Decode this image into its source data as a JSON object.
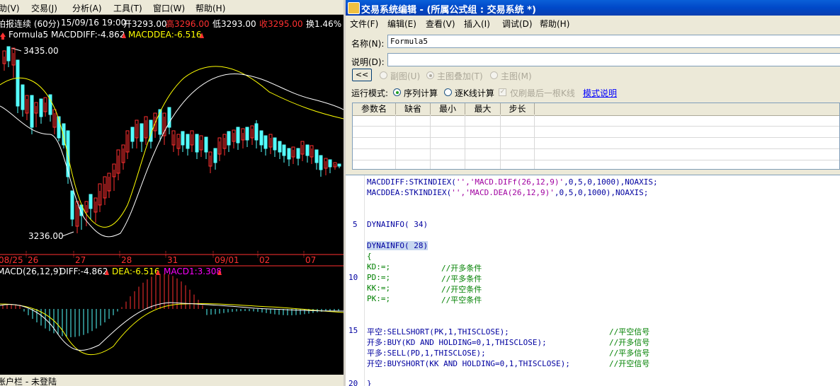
{
  "left_window": {
    "menu": [
      "助(V)",
      "交易(J)",
      "分析(A)",
      "工具(T)",
      "窗口(W)",
      "帮助(H)"
    ],
    "info": {
      "mode": "拍报连续 (60分)",
      "datetime": "15/09/16 19:00",
      "open": "开3293.00",
      "high": "高3296.00",
      "low": "低3293.00",
      "close": "收3295.00",
      "change": "换1.46%"
    },
    "formula_line": {
      "name": "Formula5",
      "diff": "MACDDIFF:-4.862",
      "dea": "MACDDEA:-6.516"
    },
    "price_high": "3435.00",
    "price_low": "3236.00",
    "date_labels": [
      "08/25",
      "26",
      "27",
      "28",
      "31",
      "09/01",
      "02",
      "07"
    ],
    "macd_line": {
      "name": "MACD(26,12,9)",
      "diff": "DIFF:-4.862",
      "dea": "DEA:-6.516",
      "macd": "MACD1:3.308"
    },
    "status": "账户栏 - 未登陆"
  },
  "editor_window": {
    "title": "交易系统编辑 - (所属公式组 : 交易系统 *)",
    "menu": [
      "文件(F)",
      "编辑(E)",
      "查看(V)",
      "插入(I)",
      "调试(D)",
      "帮助(H)"
    ],
    "name_label": "名称(N):",
    "name_value": "Formula5",
    "desc_label": "说明(D):",
    "desc_value": "",
    "collapse_button": "<<",
    "chart_options": [
      "副图(U)",
      "主图叠加(T)",
      "主图(M)"
    ],
    "run_mode_label": "运行模式:",
    "run_modes": [
      "序列计算",
      "逐K线计算"
    ],
    "last_bar_only": "仅刷最后一根K线",
    "mode_help_link": "模式说明",
    "param_headers": [
      "参数名",
      "缺省",
      "最小",
      "最大",
      "步长"
    ],
    "line_numbers": [
      "5",
      "10",
      "15",
      "20"
    ],
    "code": {
      "l1a": "MACDDIFF:",
      "l1b": "STKINDIEX(",
      "l1c": "'','MACD.DIFf(26,12,9)'",
      "l1d": ",0,5,0,1000),",
      "l1e": "NOAXIS;",
      "l2a": "MACDDEA:",
      "l2b": "STKINDIEX(",
      "l2c": "'','MACD.DEA(26,12,9)'",
      "l2d": ",0,5,0,1000),",
      "l2e": "NOAXIS;",
      "dyn34": "DYNAINFO( 34)",
      "dyn28": "DYNAINFO( 28)",
      "brace_open": "{",
      "kd": "KD:=;",
      "kd_c": "//开多条件",
      "pd": "PD:=;",
      "pd_c": "//平多条件",
      "kk": "KK:=;",
      "kk_c": "//开空条件",
      "pk": "PK:=;",
      "pk_c": "//平空条件",
      "s1": "平空:SELLSHORT(PK,1,THISCLOSE);",
      "s1_c": "//平空信号",
      "s2": "开多:BUY(KD AND HOLDING=0,1,THISCLOSE);",
      "s2_c": "//开多信号",
      "s3": "平多:SELL(PD,1,THISCLOSE);",
      "s3_c": "//平多信号",
      "s4": "开空:BUYSHORT(KK AND HOLDING=0,1,THISCLOSE);",
      "s4_c": "//开空信号",
      "brace_close": "}"
    }
  },
  "colors": {
    "up": "#ff3030",
    "down": "#54ffff",
    "diff_line": "#ffffff",
    "dea_line": "#ffff00",
    "macd_label": "#ff00ff",
    "date_label": "#ff3030"
  }
}
